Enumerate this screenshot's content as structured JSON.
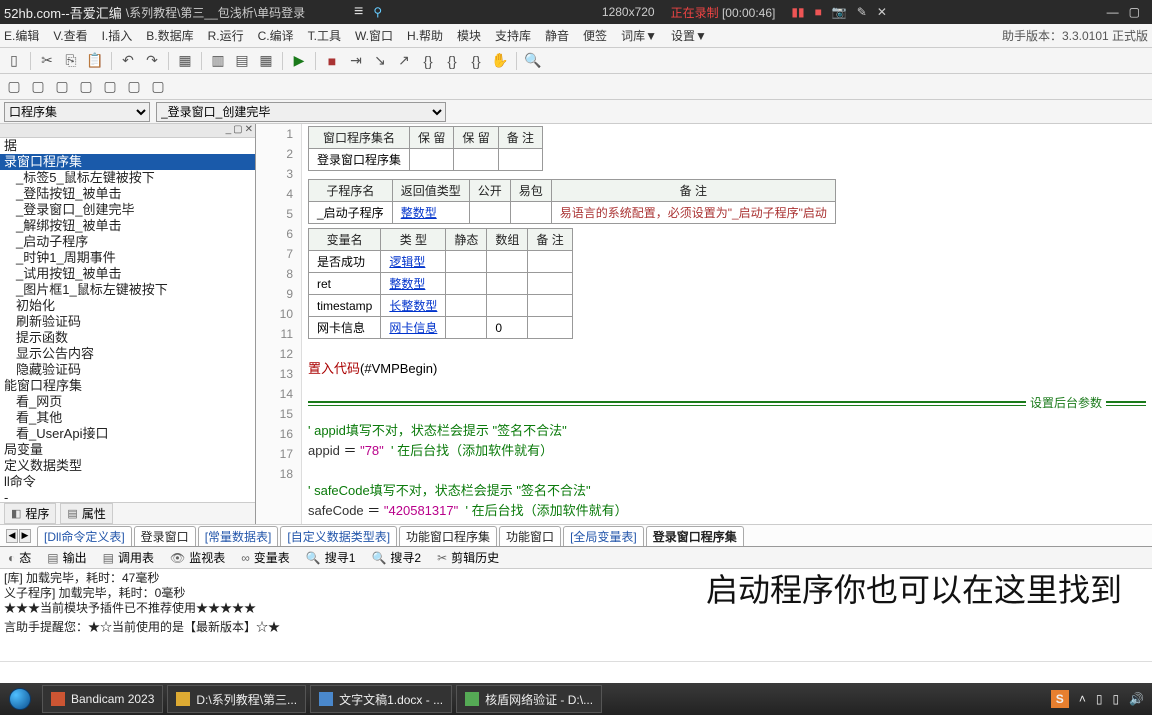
{
  "rec_bar": {
    "logo": "52hb.com--吾爱汇编",
    "path": "\\系列教程\\第三__包浅析\\单码登录",
    "resolution": "1280x720",
    "status": "正在录制",
    "time": "[00:00:46]"
  },
  "menu": {
    "items": [
      "E.编辑",
      "V.查看",
      "I.插入",
      "B.数据库",
      "R.运行",
      "C.编译",
      "T.工具",
      "W.窗口",
      "H.帮助",
      "模块",
      "支持库",
      "静音",
      "便签",
      "词库▼",
      "设置▼"
    ],
    "helper": "助手版本：3.3.0101 正式版"
  },
  "dropdowns": {
    "d1": "口程序集",
    "d2": "_登录窗口_创建完毕"
  },
  "tree": {
    "items": [
      {
        "label": "据",
        "indent": false,
        "sel": false
      },
      {
        "label": "录窗口程序集",
        "indent": false,
        "sel": true
      },
      {
        "label": "_标签5_鼠标左键被按下",
        "indent": true,
        "sel": false
      },
      {
        "label": "_登陆按钮_被单击",
        "indent": true,
        "sel": false
      },
      {
        "label": "_登录窗口_创建完毕",
        "indent": true,
        "sel": false
      },
      {
        "label": "_解绑按钮_被单击",
        "indent": true,
        "sel": false
      },
      {
        "label": "_启动子程序",
        "indent": true,
        "sel": false
      },
      {
        "label": "_时钟1_周期事件",
        "indent": true,
        "sel": false
      },
      {
        "label": "_试用按钮_被单击",
        "indent": true,
        "sel": false
      },
      {
        "label": "_图片框1_鼠标左键被按下",
        "indent": true,
        "sel": false
      },
      {
        "label": "初始化",
        "indent": true,
        "sel": false
      },
      {
        "label": "刷新验证码",
        "indent": true,
        "sel": false
      },
      {
        "label": "提示函数",
        "indent": true,
        "sel": false
      },
      {
        "label": "显示公告内容",
        "indent": true,
        "sel": false
      },
      {
        "label": "隐藏验证码",
        "indent": true,
        "sel": false
      },
      {
        "label": "能窗口程序集",
        "indent": false,
        "sel": false
      },
      {
        "label": "看_网页",
        "indent": true,
        "sel": false
      },
      {
        "label": "看_其他",
        "indent": true,
        "sel": false
      },
      {
        "label": "看_UserApi接口",
        "indent": true,
        "sel": false
      },
      {
        "label": "局变量",
        "indent": false,
        "sel": false
      },
      {
        "label": "定义数据类型",
        "indent": false,
        "sel": false
      },
      {
        "label": "ll命令",
        "indent": false,
        "sel": false
      },
      {
        "label": "-",
        "indent": false,
        "sel": false
      }
    ]
  },
  "code": {
    "table1": {
      "h1": "窗口程序集名",
      "h2": "保 留",
      "h3": "保 留",
      "h4": "备 注",
      "r1": "登录窗口程序集"
    },
    "table2": {
      "h1": "子程序名",
      "h2": "返回值类型",
      "h3": "公开",
      "h4": "易包",
      "h5": "备 注",
      "r1_name": "_启动子程序",
      "r1_type": "整数型",
      "r1_note": "易语言的系统配置，必须设置为\"_启动子程序\"启动"
    },
    "table3": {
      "h1": "变量名",
      "h2": "类 型",
      "h3": "静态",
      "h4": "数组",
      "h5": "备 注",
      "rows": [
        {
          "name": "是否成功",
          "type": "逻辑型",
          "arr": ""
        },
        {
          "name": "ret",
          "type": "整数型",
          "arr": ""
        },
        {
          "name": "timestamp",
          "type": "长整数型",
          "arr": ""
        },
        {
          "name": "网卡信息",
          "type": "网卡信息",
          "arr": "0"
        }
      ]
    },
    "line11": "置入代码",
    "line11_p": "(#VMPBegin)",
    "section_label": "设置后台参数",
    "c14": "'  appid填写不对，状态栏会提示 \"签名不合法\"",
    "c15_id": "appid",
    "c15_eq": "＝",
    "c15_val": "\"78\"",
    "c15_cmt": "'  在后台找（添加软件就有）",
    "c17": "'  safeCode填写不对，状态栏会提示 \"签名不合法\"",
    "c18_id": "safeCode",
    "c18_eq": "＝",
    "c18_val": "\"420581317\"",
    "c18_cmt": "'  在后台找（添加软件就有）"
  },
  "tree_tabs": {
    "t1": "程序",
    "t2": "属性"
  },
  "code_tabs": {
    "tabs": [
      {
        "label": "[Dll命令定义表]",
        "blue": true
      },
      {
        "label": "登录窗口",
        "blue": false
      },
      {
        "label": "[常量数据表]",
        "blue": true
      },
      {
        "label": "[自定义数据类型表]",
        "blue": true
      },
      {
        "label": "功能窗口程序集",
        "blue": false
      },
      {
        "label": "功能窗口",
        "blue": false
      },
      {
        "label": "[全局变量表]",
        "blue": true
      },
      {
        "label": "登录窗口程序集",
        "blue": false,
        "active": true
      }
    ]
  },
  "output_tabs": {
    "t1": "态",
    "t2": "输出",
    "t3": "调用表",
    "t4": "监视表",
    "t5": "变量表",
    "t6": "搜寻1",
    "t7": "搜寻2",
    "t8": "剪辑历史"
  },
  "output_lines": {
    "l1": "[库] 加载完毕，耗时：47毫秒",
    "l2": "义子程序] 加载完毕，耗时：0毫秒",
    "l3": "★★★当前模块予插件已不推荐使用★★★★★",
    "l4": "言助手提醒您：★☆当前使用的是【最新版本】☆★"
  },
  "big_text": "启动程序你也可以在这里找到",
  "taskbar": {
    "items": [
      {
        "label": "Bandicam 2023",
        "icon": "r"
      },
      {
        "label": "D:\\系列教程\\第三...",
        "icon": "y"
      },
      {
        "label": "文字文稿1.docx - ...",
        "icon": "b"
      },
      {
        "label": "核盾网络验证 - D:\\...",
        "icon": "g"
      }
    ]
  }
}
